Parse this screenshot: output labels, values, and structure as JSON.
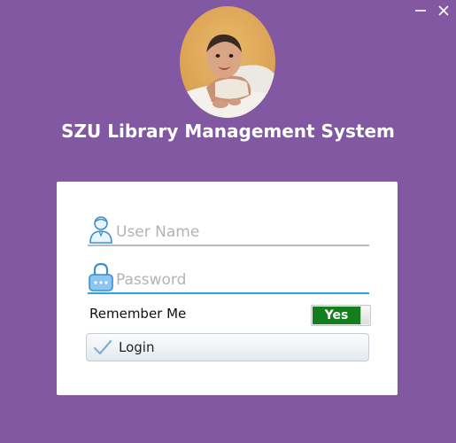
{
  "window": {
    "title": "SZU Library Management System",
    "minimize_icon": "minimize-icon",
    "close_icon": "close-icon"
  },
  "colors": {
    "background": "#8258a2",
    "card": "#ffffff",
    "active_underline": "#2aa6dc",
    "toggle_on": "#127e1e"
  },
  "login": {
    "username": {
      "icon": "user-icon",
      "value": "",
      "placeholder": "User Name"
    },
    "password": {
      "icon": "lock-icon",
      "value": "",
      "placeholder": "Password"
    },
    "remember_label": "Remember Me",
    "remember_toggle": {
      "state_label": "Yes",
      "checked": true
    },
    "login_button": {
      "icon": "checkmark-icon",
      "label": "Login"
    }
  }
}
